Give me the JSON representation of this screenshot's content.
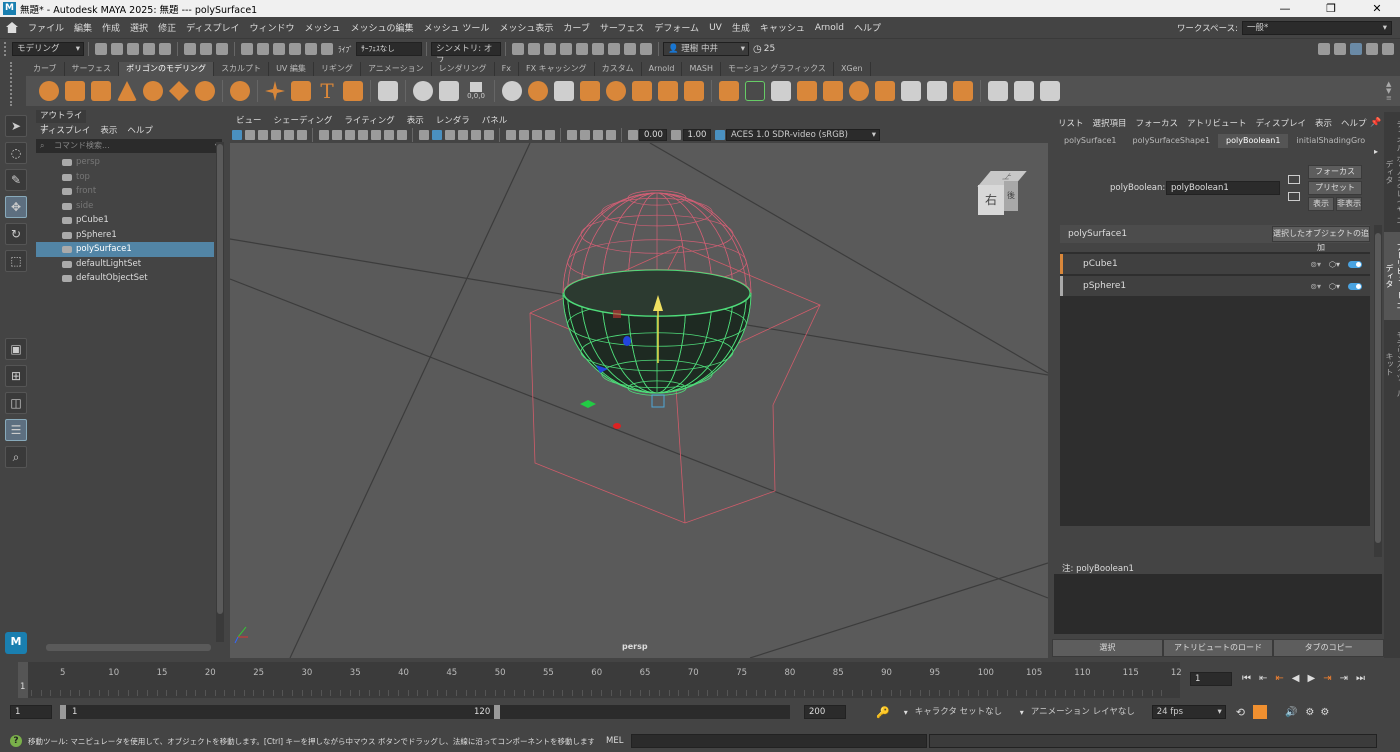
{
  "titlebar": {
    "title": "無題* - Autodesk MAYA 2025: 無題   ---   polySurface1",
    "logo": "M",
    "min": "—",
    "max": "❐",
    "close": "✕"
  },
  "menubar": {
    "items": [
      "ファイル",
      "編集",
      "作成",
      "選択",
      "修正",
      "ディスプレイ",
      "ウィンドウ",
      "メッシュ",
      "メッシュの編集",
      "メッシュ ツール",
      "メッシュ表示",
      "カーブ",
      "サーフェス",
      "デフォーム",
      "UV",
      "生成",
      "キャッシュ",
      "Arnold",
      "ヘルプ"
    ],
    "workspace_label": "ワークスペース:",
    "workspace_value": "一般*"
  },
  "statusline": {
    "mode": "モデリング",
    "live": "ﾗｲﾌﾞ",
    "live_value": "ｻｰﾌｪｽなし",
    "symmetry": "シンメトリ: オフ",
    "user": "理樹 中井",
    "credits": "25"
  },
  "shelf": {
    "tabs": [
      "カーブ",
      "サーフェス",
      "ポリゴンのモデリング",
      "スカルプト",
      "UV 編集",
      "リギング",
      "アニメーション",
      "レンダリング",
      "Fx",
      "FX キャッシング",
      "カスタム",
      "Arnold",
      "MASH",
      "モーション グラフィックス",
      "XGen"
    ],
    "active_tab": "ポリゴンのモデリング",
    "coords": "0,0,0",
    "accent": "#d9873a"
  },
  "outliner": {
    "title": "アウトライナ",
    "menu": [
      "ディスプレイ",
      "表示",
      "ヘルプ"
    ],
    "search_placeholder": "コマンド検索...",
    "items": [
      {
        "label": "persp",
        "dim": true
      },
      {
        "label": "top",
        "dim": true
      },
      {
        "label": "front",
        "dim": true
      },
      {
        "label": "side",
        "dim": true
      },
      {
        "label": "pCube1"
      },
      {
        "label": "pSphere1"
      },
      {
        "label": "polySurface1",
        "selected": true
      },
      {
        "label": "defaultLightSet"
      },
      {
        "label": "defaultObjectSet"
      }
    ]
  },
  "viewport": {
    "menu": [
      "ビュー",
      "シェーディング",
      "ライティング",
      "表示",
      "レンダラ",
      "パネル"
    ],
    "exposure": "0.00",
    "gamma": "1.00",
    "colorspace": "ACES 1.0 SDR-video (sRGB)",
    "camera_label": "persp",
    "cube_right": "右",
    "cube_back": "後",
    "cube_top": "上"
  },
  "attribute_editor": {
    "menu": [
      "リスト",
      "選択項目",
      "フォーカス",
      "アトリビュート",
      "ディスプレイ",
      "表示",
      "ヘルプ"
    ],
    "tabs": [
      "polySurface1",
      "polySurfaceShape1",
      "polyBoolean1",
      "initialShadingGro"
    ],
    "active_tab": "polyBoolean1",
    "node_label": "polyBoolean:",
    "node_value": "polyBoolean1",
    "focus_btn": "フォーカス",
    "preset_btn": "プリセット",
    "show_btn": "表示",
    "hide_btn": "非表示",
    "section": "polySurface1",
    "add_selected": "選択したオブジェクトの追加",
    "operands": [
      {
        "name": "pCube1",
        "color": "#d9873a"
      },
      {
        "name": "pSphere1",
        "color": "#aaaaaa"
      }
    ],
    "notes_label": "注:  polyBoolean1",
    "btn_select": "選択",
    "btn_load": "アトリビュートのロード",
    "btn_copy": "タブのコピー"
  },
  "sidetabs": [
    "チャネル ボックス/レイヤ エディタ",
    "アトリビュート エディタ",
    "モデリング ツールキット"
  ],
  "timeline": {
    "ticks": [
      "5",
      "10",
      "15",
      "20",
      "25",
      "30",
      "35",
      "40",
      "45",
      "50",
      "55",
      "60",
      "65",
      "70",
      "75",
      "80",
      "85",
      "90",
      "95",
      "100",
      "105",
      "110",
      "115",
      "12"
    ],
    "current_marker": "1",
    "current_frame": "1"
  },
  "range": {
    "start": "1",
    "inner_start": "1",
    "inner_end": "120",
    "end": "200",
    "character_set": "キャラクタ セットなし",
    "anim_layer": "アニメーション レイヤなし",
    "fps": "24 fps"
  },
  "cmd": {
    "help": "移動ツール: マニピュレータを使用して、オブジェクトを移動します。[Ctrl] キーを押しながら中マウス ボタンでドラッグし、法線に沿ってコンポーネントを移動します。[Shift] キーを押しながらマニピュ",
    "lang": "MEL"
  }
}
